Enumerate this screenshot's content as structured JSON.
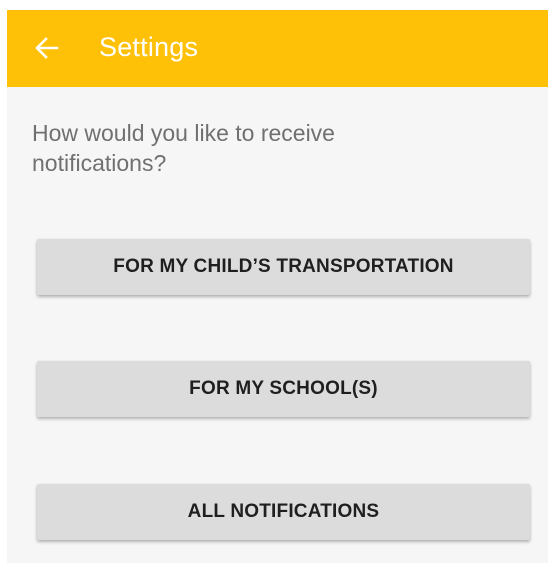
{
  "appbar": {
    "title": "Settings",
    "back_icon": "arrow-left-icon",
    "color": "#ffc107"
  },
  "main": {
    "prompt": "How would you like to receive notifications?",
    "buttons": [
      {
        "label": "FOR MY CHILD’S TRANSPORTATION"
      },
      {
        "label": "FOR MY SCHOOL(S)"
      },
      {
        "label": "ALL NOTIFICATIONS"
      }
    ]
  }
}
